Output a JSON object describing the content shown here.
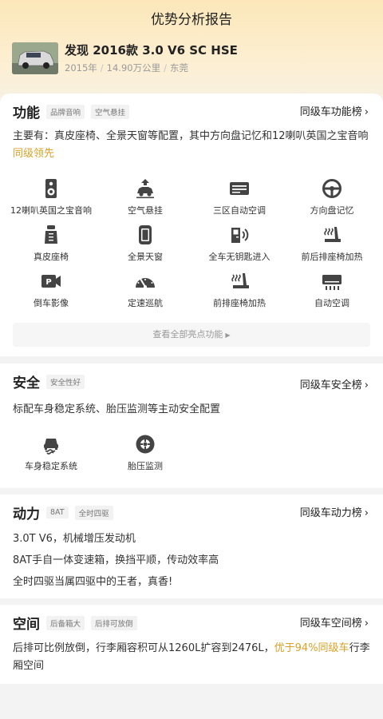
{
  "header": {
    "title": "优势分析报告"
  },
  "car": {
    "name": "发现 2016款 3.0 V6 SC HSE",
    "year": "2015年",
    "mileage": "14.90万公里",
    "city": "东莞",
    "sep": "/"
  },
  "function": {
    "title": "功能",
    "tags": [
      "品牌音响",
      "空气悬挂"
    ],
    "rank_link": "同级车功能榜",
    "desc_prefix": "主要有：真皮座椅、全景天窗等配置，其中方向盘记忆和12喇叭英国之宝音响",
    "desc_highlight": "同级领先",
    "features": [
      {
        "label": "12喇叭英国之宝音响",
        "icon": "speaker-icon"
      },
      {
        "label": "空气悬挂",
        "icon": "air-suspension-icon"
      },
      {
        "label": "三区自动空调",
        "icon": "climate-control-icon"
      },
      {
        "label": "方向盘记忆",
        "icon": "steering-wheel-icon"
      },
      {
        "label": "真皮座椅",
        "icon": "leather-seat-icon"
      },
      {
        "label": "全景天窗",
        "icon": "panoramic-sunroof-icon"
      },
      {
        "label": "全车无钥匙进入",
        "icon": "keyless-entry-icon"
      },
      {
        "label": "前后排座椅加热",
        "icon": "seat-heating-icon"
      },
      {
        "label": "倒车影像",
        "icon": "reverse-camera-icon"
      },
      {
        "label": "定速巡航",
        "icon": "cruise-control-icon"
      },
      {
        "label": "前排座椅加热",
        "icon": "front-seat-heating-icon"
      },
      {
        "label": "自动空调",
        "icon": "auto-ac-icon"
      }
    ],
    "view_all": "查看全部亮点功能"
  },
  "safety": {
    "title": "安全",
    "tags": [
      "安全性好"
    ],
    "rank_link": "同级车安全榜",
    "desc": "标配车身稳定系统、胎压监测等主动安全配置",
    "features": [
      {
        "label": "车身稳定系统",
        "icon": "stability-control-icon"
      },
      {
        "label": "胎压监测",
        "icon": "tire-pressure-icon"
      }
    ]
  },
  "power": {
    "title": "动力",
    "tags": [
      "8AT",
      "全时四驱"
    ],
    "rank_link": "同级车动力榜",
    "lines": [
      "3.0T V6，机械增压发动机",
      "8AT手自一体变速箱，换挡平顺，传动效率高",
      "全时四驱当属四驱中的王者，真香!"
    ]
  },
  "space": {
    "title": "空间",
    "tags": [
      "后备箱大",
      "后排可放倒"
    ],
    "rank_link": "同级车空间榜",
    "desc_prefix": "后排可比例放倒，行李厢容积可从1260L扩容到2476L，",
    "desc_highlight": "优于94%同级车",
    "desc_suffix": "行李厢空间"
  },
  "colors": {
    "accent": "#d9a227",
    "hero_top": "#fbe7b9"
  }
}
